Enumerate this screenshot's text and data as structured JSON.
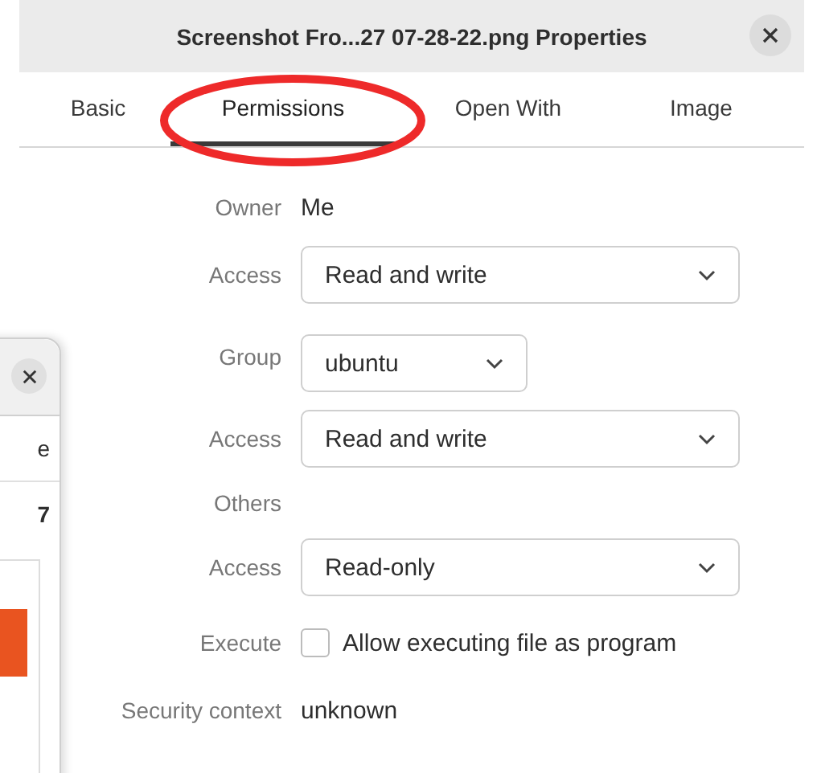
{
  "window": {
    "title": "Screenshot Fro...27 07-28-22.png Properties"
  },
  "tabs": [
    {
      "label": "Basic",
      "selected": false
    },
    {
      "label": "Permissions",
      "selected": true
    },
    {
      "label": "Open With",
      "selected": false
    },
    {
      "label": "Image",
      "selected": false
    }
  ],
  "rows": [
    {
      "kind": "value",
      "label": "Owner",
      "value": "Me"
    },
    {
      "kind": "dropdown",
      "label": "Access",
      "value": "Read and write"
    },
    {
      "kind": "small-dropdown",
      "label": "Group",
      "value": "ubuntu"
    },
    {
      "kind": "dropdown",
      "label": "Access",
      "value": "Read and write"
    },
    {
      "kind": "heading",
      "label": "Others"
    },
    {
      "kind": "dropdown",
      "label": "Access",
      "value": "Read-only"
    },
    {
      "kind": "checkbox",
      "label": "Execute",
      "text": "Allow executing file as program",
      "checked": false
    },
    {
      "kind": "value",
      "label": "Security context",
      "value": "unknown"
    }
  ],
  "back_window": {
    "lines": [
      "e",
      "7"
    ]
  }
}
